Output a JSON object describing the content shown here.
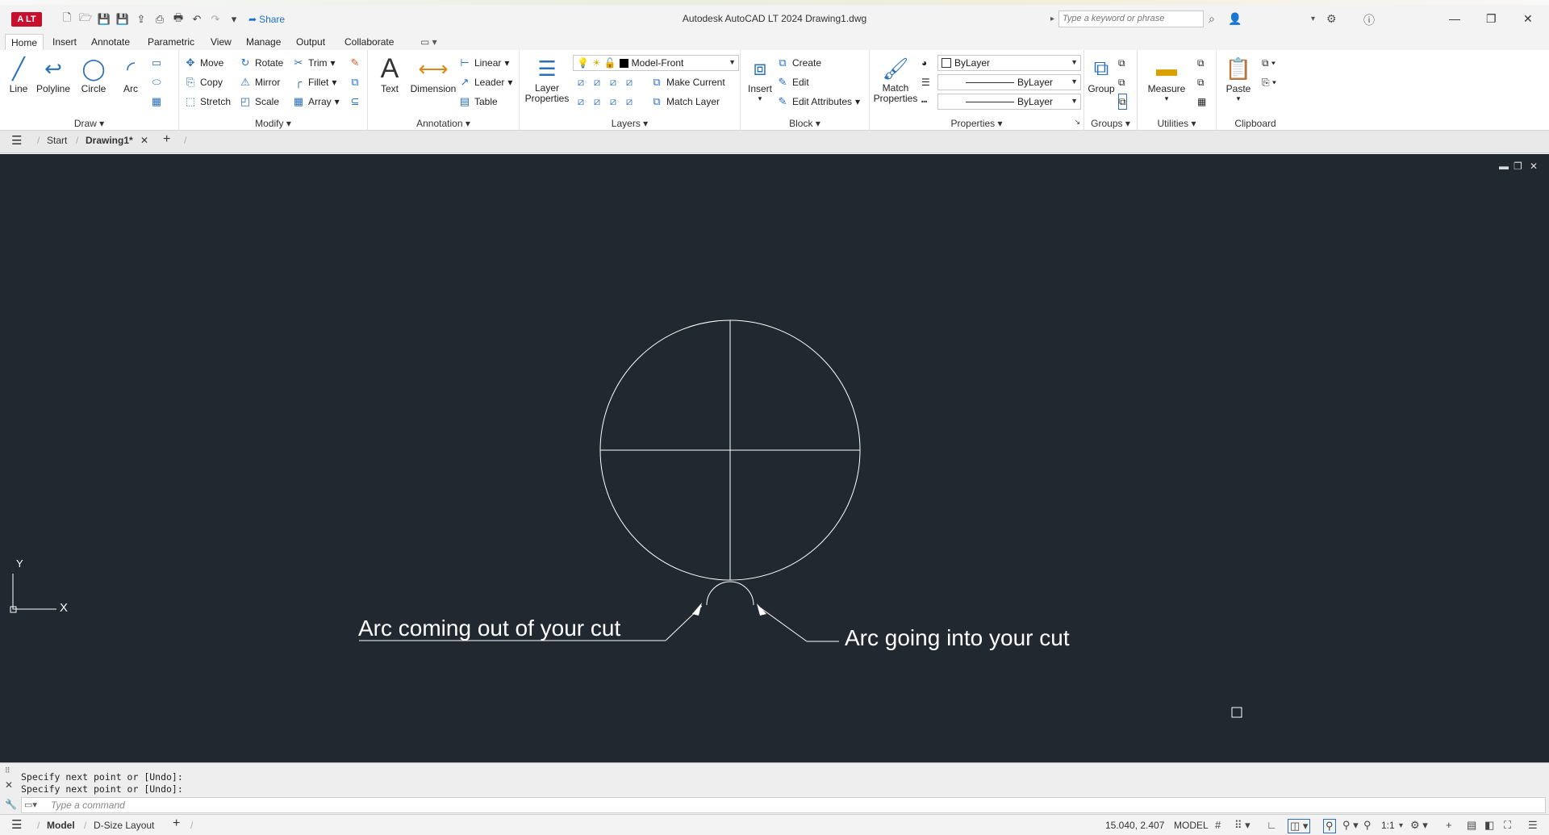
{
  "app": {
    "title": "Autodesk AutoCAD LT 2024    Drawing1.dwg",
    "logo_text": "A LT",
    "share_label": "Share",
    "search_placeholder": "Type a keyword or phrase"
  },
  "ribbon_tabs": [
    "Home",
    "Insert",
    "Annotate",
    "Parametric",
    "View",
    "Manage",
    "Output",
    "Collaborate"
  ],
  "panels": {
    "draw": {
      "label": "Draw",
      "line": "Line",
      "polyline": "Polyline",
      "circle": "Circle",
      "arc": "Arc"
    },
    "modify": {
      "label": "Modify",
      "move": "Move",
      "rotate": "Rotate",
      "trim": "Trim",
      "copy": "Copy",
      "mirror": "Mirror",
      "fillet": "Fillet",
      "stretch": "Stretch",
      "scale": "Scale",
      "array": "Array"
    },
    "annotation": {
      "label": "Annotation",
      "text": "Text",
      "dimension": "Dimension",
      "linear": "Linear",
      "leader": "Leader",
      "table": "Table"
    },
    "layers": {
      "label": "Layers",
      "layer_properties": "Layer Properties",
      "current_layer": "Model-Front",
      "make_current": "Make Current",
      "match_layer": "Match Layer"
    },
    "block": {
      "label": "Block",
      "insert": "Insert",
      "create": "Create",
      "edit": "Edit",
      "edit_attributes": "Edit Attributes"
    },
    "properties": {
      "label": "Properties",
      "match_properties": "Match Properties",
      "color": "ByLayer",
      "linetype": "ByLayer",
      "lineweight": "ByLayer"
    },
    "groups": {
      "label": "Groups",
      "group": "Group"
    },
    "utilities": {
      "label": "Utilities",
      "measure": "Measure"
    },
    "clipboard": {
      "label": "Clipboard",
      "paste": "Paste"
    }
  },
  "file_tabs": {
    "start": "Start",
    "drawing": "Drawing1*"
  },
  "drawing": {
    "label_left": "Arc coming out of your cut",
    "label_right": "Arc going into your cut",
    "ucs_x": "X",
    "ucs_y": "Y"
  },
  "command": {
    "history": [
      "Specify next point or [Undo]:",
      "Specify next point or [Undo]:"
    ],
    "placeholder": "Type a command"
  },
  "status": {
    "layout_tabs": [
      "Model",
      "D-Size Layout"
    ],
    "coords": "15.040, 2.407",
    "space": "MODEL",
    "scale": "1:1"
  }
}
